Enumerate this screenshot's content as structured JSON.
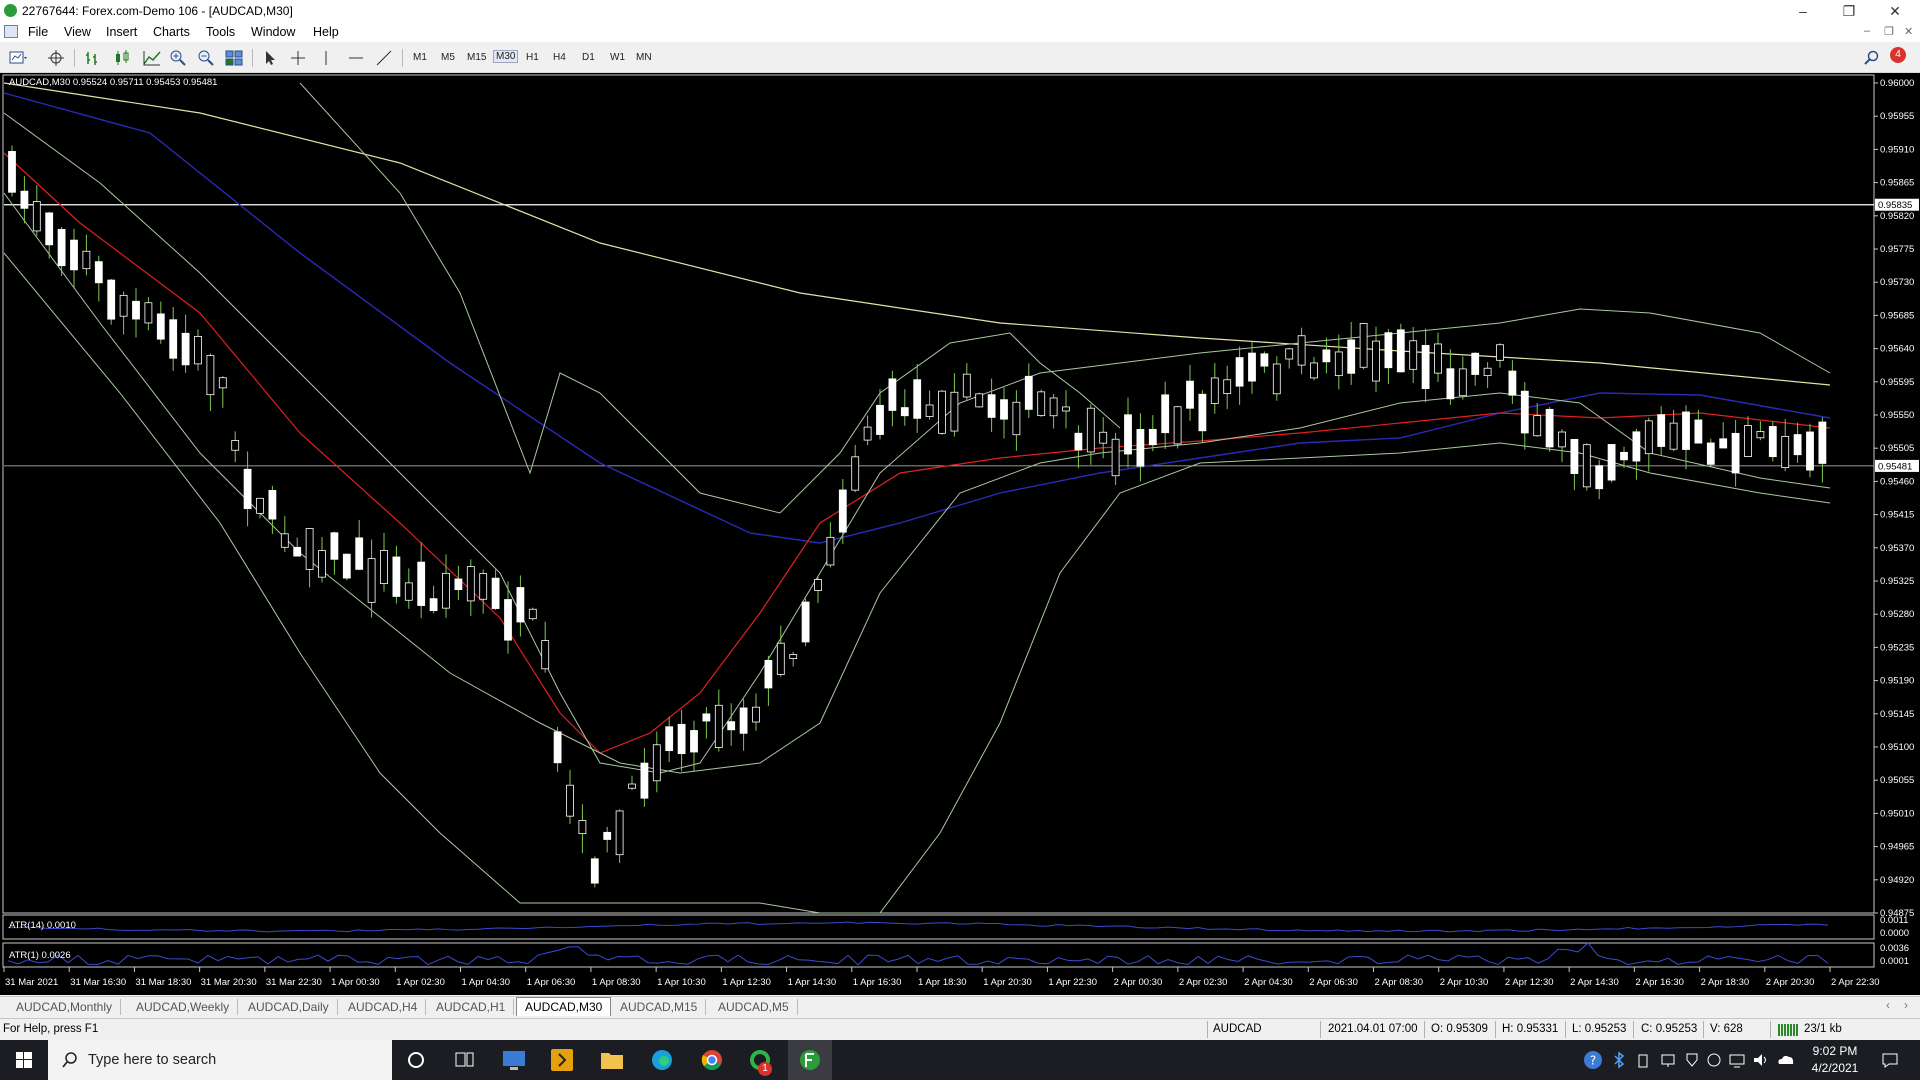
{
  "window": {
    "title": "22767644: Forex.com-Demo 106 - [AUDCAD,M30]",
    "minimize": "–",
    "restore": "❐",
    "close": "✕"
  },
  "menu": {
    "items": [
      "File",
      "View",
      "Insert",
      "Charts",
      "Tools",
      "Window",
      "Help"
    ],
    "mdi_controls": [
      "–",
      "❐",
      "✕"
    ]
  },
  "toolbar": {
    "timeframes": [
      "M1",
      "M5",
      "M15",
      "M30",
      "H1",
      "H4",
      "D1",
      "W1",
      "MN"
    ],
    "active_timeframe": "M30",
    "alert_count": "4"
  },
  "chart": {
    "info": "AUDCAD,M30  0.95524 0.95711 0.95453 0.95481",
    "atr14_label": "ATR(14) 0.0010",
    "atr1_label": "ATR(1) 0.0026",
    "price_labels": [
      "0.96000",
      "0.95955",
      "0.95910",
      "0.95865",
      "0.95820",
      "0.95775",
      "0.95730",
      "0.95685",
      "0.95640",
      "0.95595",
      "0.95550",
      "0.95505",
      "0.95460",
      "0.95415",
      "0.95370",
      "0.95325",
      "0.95280",
      "0.95235",
      "0.95190",
      "0.95145",
      "0.95100",
      "0.95055",
      "0.95010",
      "0.94965",
      "0.94920",
      "0.94875"
    ],
    "hline_price_label": "0.95835",
    "current_price_label": "0.95481",
    "atr14_scale": [
      "0.0011",
      "0.0000"
    ],
    "atr1_scale": [
      "0.0036",
      "0.0001"
    ],
    "time_labels": [
      "31 Mar 2021",
      "31 Mar 16:30",
      "31 Mar 18:30",
      "31 Mar 20:30",
      "31 Mar 22:30",
      "1 Apr 00:30",
      "1 Apr 02:30",
      "1 Apr 04:30",
      "1 Apr 06:30",
      "1 Apr 08:30",
      "1 Apr 10:30",
      "1 Apr 12:30",
      "1 Apr 14:30",
      "1 Apr 16:30",
      "1 Apr 18:30",
      "1 Apr 20:30",
      "1 Apr 22:30",
      "2 Apr 00:30",
      "2 Apr 02:30",
      "2 Apr 04:30",
      "2 Apr 06:30",
      "2 Apr 08:30",
      "2 Apr 10:30",
      "2 Apr 12:30",
      "2 Apr 14:30",
      "2 Apr 16:30",
      "2 Apr 18:30",
      "2 Apr 20:30",
      "2 Apr 22:30"
    ],
    "colors": {
      "background": "#000000",
      "bull_body": "#ffffff",
      "wick": "#7ec850",
      "bands": "#a9c9a0",
      "ma_red": "#e02020",
      "ma_blue": "#2a2ab8",
      "ma_yellow": "#e3e3a8",
      "atr": "#3a4bd0"
    }
  },
  "chart_tabs": {
    "items": [
      "AUDCAD,Monthly",
      "AUDCAD,Weekly",
      "AUDCAD,Daily",
      "AUDCAD,H4",
      "AUDCAD,H1",
      "AUDCAD,M30",
      "AUDCAD,M15",
      "AUDCAD,M5"
    ],
    "active": "AUDCAD,M30"
  },
  "status": {
    "help": "For Help, press F1",
    "symbol": "AUDCAD",
    "datetime": "2021.04.01 07:00",
    "open": "O: 0.95309",
    "high": "H: 0.95331",
    "low": "L: 0.95253",
    "close": "C: 0.95253",
    "volume": "V: 628",
    "connection": "23/1 kb"
  },
  "taskbar": {
    "search_placeholder": "Type here to search",
    "time": "9:02 PM",
    "date": "4/2/2021",
    "app_badge": "1"
  }
}
